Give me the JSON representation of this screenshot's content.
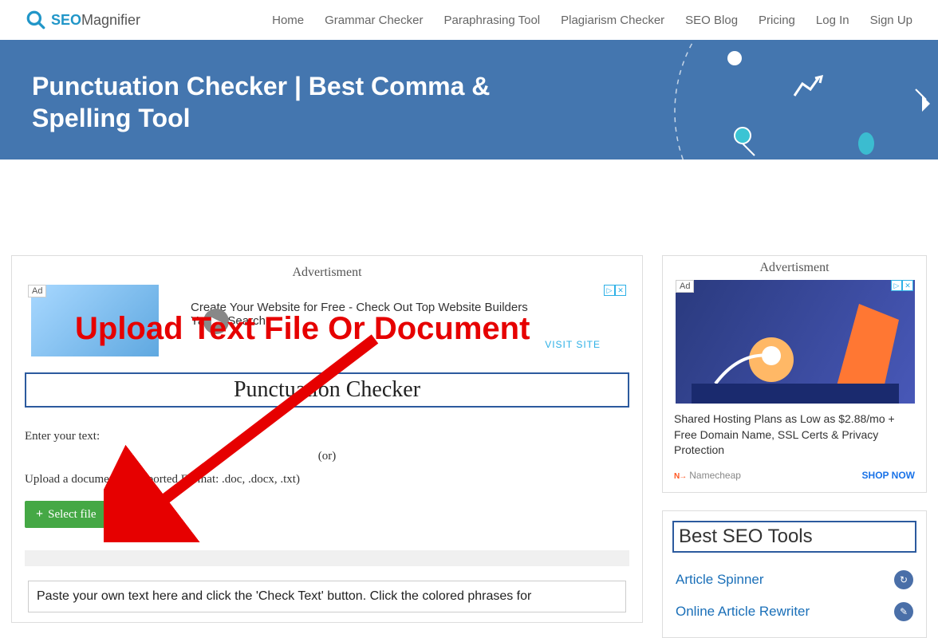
{
  "logo": {
    "seo": "SEO",
    "mag": "Magnifier"
  },
  "nav": {
    "home": "Home",
    "grammar": "Grammar Checker",
    "paraphrase": "Paraphrasing Tool",
    "plagiarism": "Plagiarism Checker",
    "blog": "SEO Blog",
    "pricing": "Pricing",
    "login": "Log In",
    "signup": "Sign Up"
  },
  "hero": {
    "title": "Punctuation Checker | Best Comma & Spelling Tool"
  },
  "main": {
    "adv_label": "Advertisment",
    "ad_badge": "Ad",
    "ad_text_l1": "Create Your Website for Free - Check Out Top Website Builders",
    "ad_text_l2": "Yahoo Search",
    "ad_visit": "VISIT SITE",
    "tool_title": "Punctuation Checker",
    "enter_text": "Enter your text:",
    "or": "(or)",
    "upload_label": "Upload a document:   (Supported Format: .doc, .docx, .txt)",
    "select_file": "Select file",
    "textarea_hint": "Paste your own text here and click the 'Check Text' button. Click the colored phrases for"
  },
  "sidebar": {
    "adv_label": "Advertisment",
    "ad_badge": "Ad",
    "ad_desc": "Shared Hosting Plans as Low as $2.88/mo + Free Domain Name, SSL Certs & Privacy Protection",
    "ad_brand": "Namecheap",
    "ad_cta": "SHOP NOW",
    "tools_title": "Best SEO Tools",
    "tool1": "Article Spinner",
    "tool2": "Online Article Rewriter"
  },
  "overlay": "Upload Text File Or Document"
}
